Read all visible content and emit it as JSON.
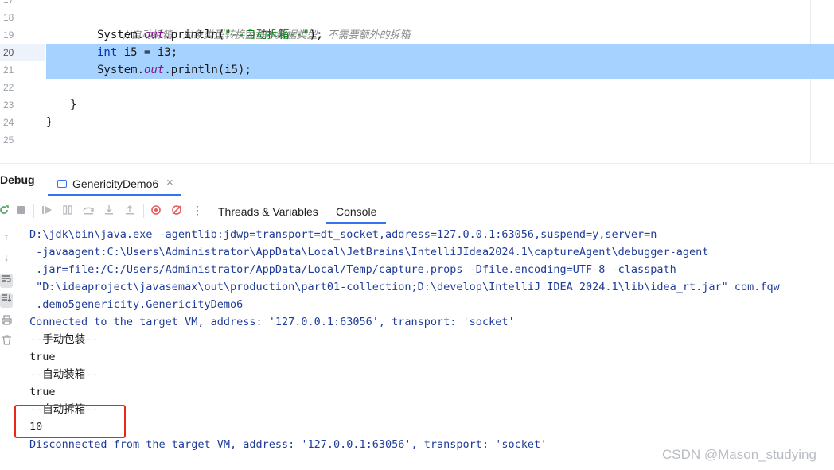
{
  "editor": {
    "line_numbers": [
      "17",
      "18",
      "19",
      "20",
      "21",
      "22",
      "23",
      "24",
      "25"
    ],
    "current_line": "20",
    "lines": {
      "l18_comment": "//自动拆箱：对象类型转换为基本数据类型，不需要额外的拆箱",
      "l19_prefix": "System.",
      "l19_field": "out",
      "l19_call": ".println(",
      "l19_string": "\"--自动拆箱--\"",
      "l19_end": ");",
      "l20_kw": "int",
      "l20_rest": " i5 = i3;",
      "l21_prefix": "System.",
      "l21_field": "out",
      "l21_rest": ".println(i5);",
      "l23": "}",
      "l24": "}"
    }
  },
  "debug": {
    "title": "Debug",
    "session_tab": "GenericityDemo6",
    "close_glyph": "×",
    "tabs": {
      "threads": "Threads & Variables",
      "console": "Console"
    },
    "more_glyph": "⋮"
  },
  "console": {
    "lines": [
      {
        "text": "D:\\jdk\\bin\\java.exe -agentlib:jdwp=transport=dt_socket,address=127.0.0.1:63056,suspend=y,server=n",
        "kind": "sys"
      },
      {
        "text": " -javaagent:C:\\Users\\Administrator\\AppData\\Local\\JetBrains\\IntelliJIdea2024.1\\captureAgent\\debugger-agent",
        "kind": "sys"
      },
      {
        "text": " .jar=file:/C:/Users/Administrator/AppData/Local/Temp/capture.props -Dfile.encoding=UTF-8 -classpath",
        "kind": "sys"
      },
      {
        "text": " \"D:\\ideaproject\\javasemax\\out\\production\\part01-collection;D:\\develop\\IntelliJ IDEA 2024.1\\lib\\idea_rt.jar\" com.fqw",
        "kind": "sys"
      },
      {
        "text": " .demo5genericity.GenericityDemo6",
        "kind": "sys"
      },
      {
        "text": "Connected to the target VM, address: '127.0.0.1:63056', transport: 'socket'",
        "kind": "sys"
      },
      {
        "text": "--手动包装--",
        "kind": "out"
      },
      {
        "text": "true",
        "kind": "out"
      },
      {
        "text": "--自动装箱--",
        "kind": "out"
      },
      {
        "text": "true",
        "kind": "out"
      },
      {
        "text": "--自动拆箱--",
        "kind": "out"
      },
      {
        "text": "10",
        "kind": "out"
      },
      {
        "text": "Disconnected from the target VM, address: '127.0.0.1:63056', transport: 'socket'",
        "kind": "sys"
      }
    ]
  },
  "watermark": "CSDN @Mason_studying",
  "colors": {
    "accent": "#3574f0",
    "selection": "#a6d2ff",
    "highlight_box": "#e8281d"
  }
}
